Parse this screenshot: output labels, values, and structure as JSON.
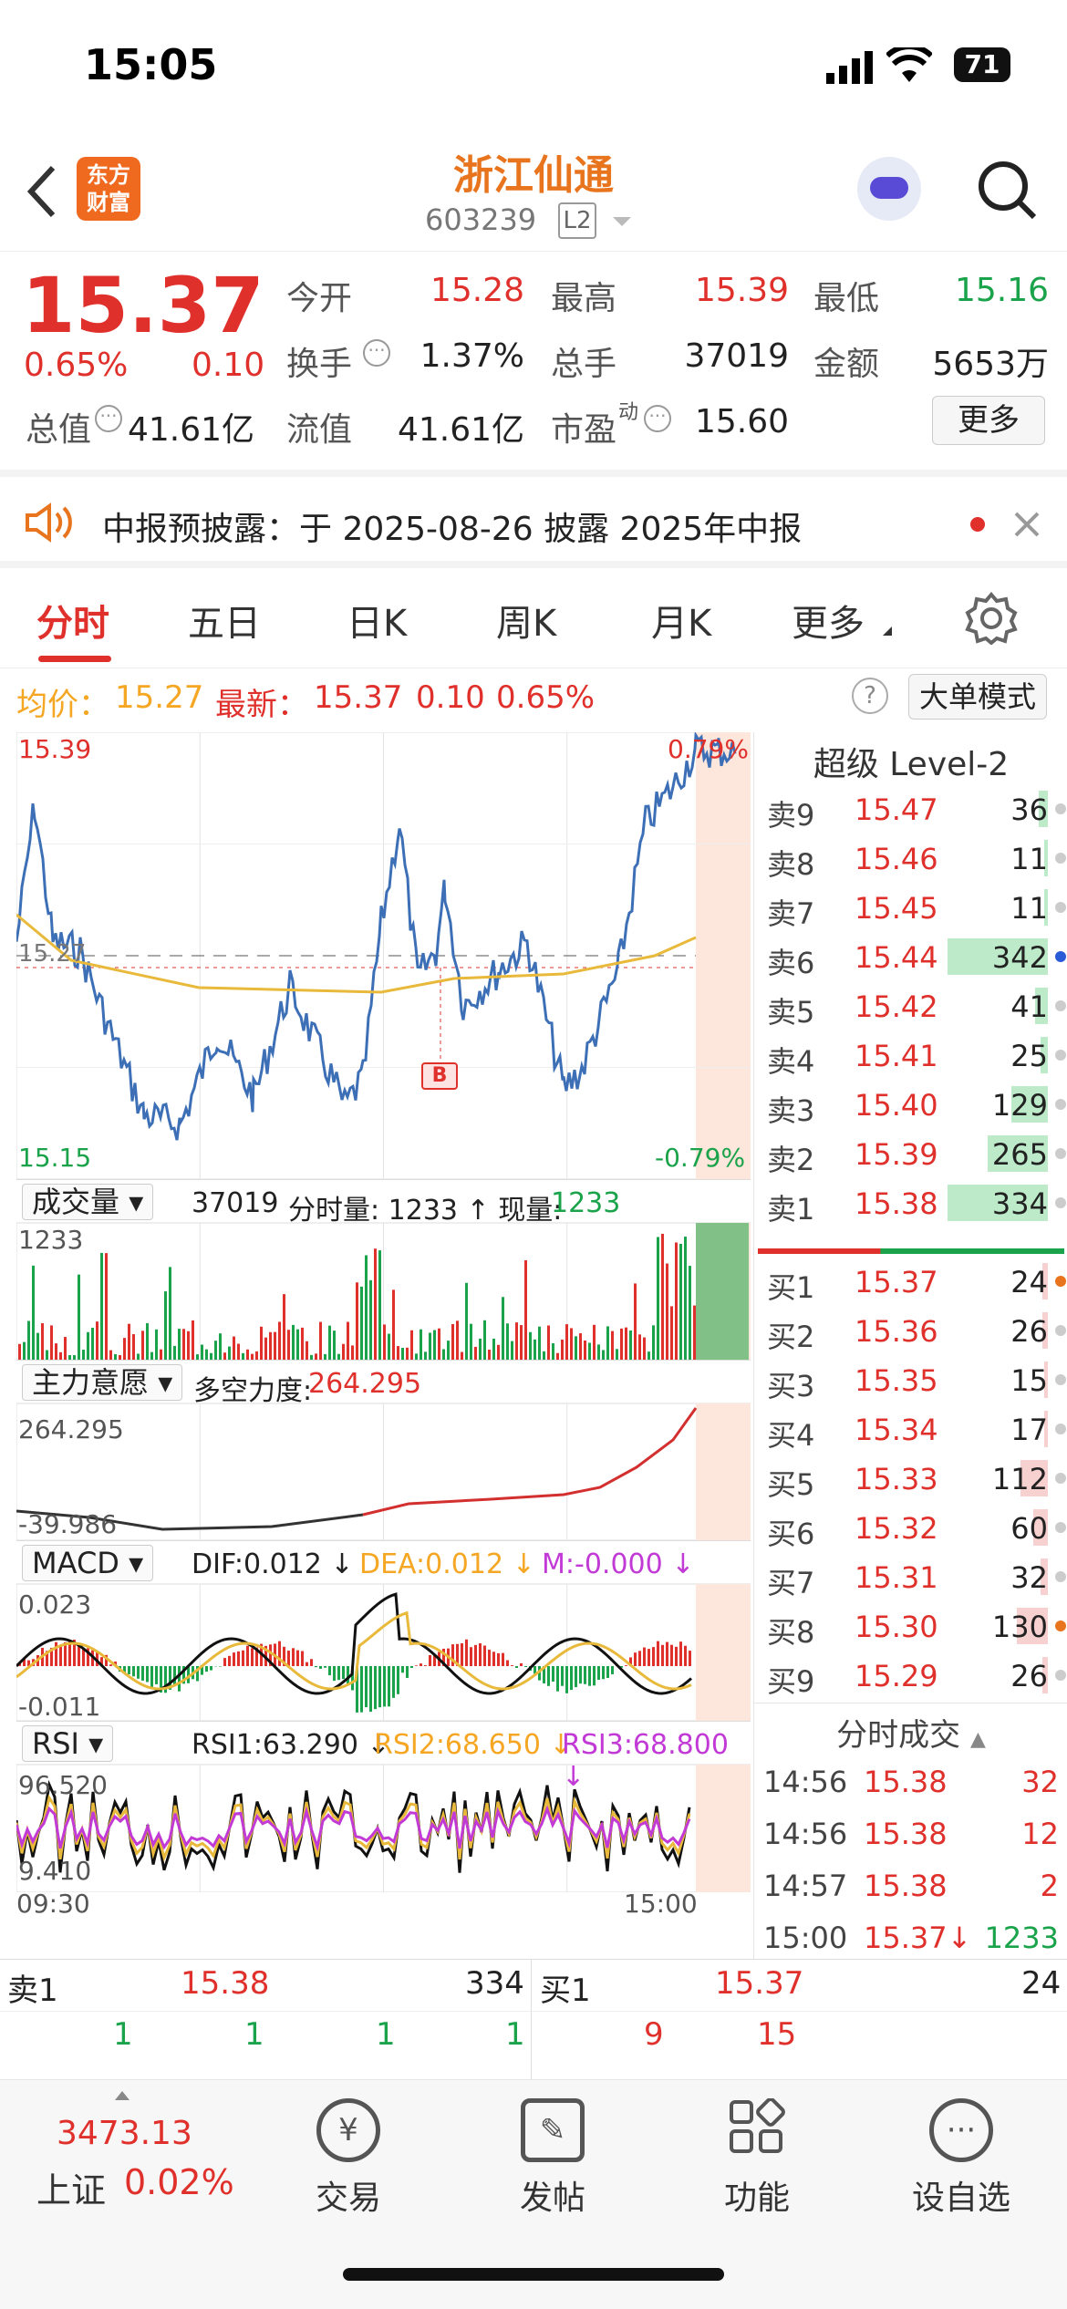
{
  "status": {
    "time": "15:05",
    "battery": "71"
  },
  "header": {
    "logo": "东方\n财富",
    "stock_name": "浙江仙通",
    "stock_code": "603239",
    "level_badge": "L2"
  },
  "quote": {
    "price": "15.37",
    "change_pct": "0.65%",
    "change": "0.10",
    "open_label": "今开",
    "open": "15.28",
    "high_label": "最高",
    "high": "15.39",
    "low_label": "最低",
    "low": "15.16",
    "turnover_label": "换手",
    "turnover": "1.37%",
    "volume_label": "总手",
    "volume": "37019",
    "amount_label": "金额",
    "amount": "5653万",
    "mcap_label": "总值",
    "mcap": "41.61亿",
    "float_label": "流值",
    "float": "41.61亿",
    "pe_label": "市盈",
    "pe_sup": "动",
    "pe": "15.60",
    "more": "更多"
  },
  "notice": {
    "text": "中报预披露：于 2025-08-26 披露 2025年中报"
  },
  "tabs": [
    "分时",
    "五日",
    "日K",
    "周K",
    "月K",
    "更多"
  ],
  "avg": {
    "avg_label": "均价：",
    "avg": "15.27",
    "latest_label": "最新：",
    "latest": "15.37",
    "chg": "0.10",
    "pct": "0.65%",
    "mode": "大单模式"
  },
  "chart": {
    "y_top": "15.39",
    "y_bottom": "15.15",
    "y_mid": "15.27",
    "pct_top": "0.79%",
    "pct_bottom": "-0.79%",
    "x_start": "09:30",
    "x_end": "15:00",
    "marker": "B"
  },
  "volume_panel": {
    "selector": "成交量",
    "total": "37019",
    "label": "分时量: 1233 ↑ 现量: ",
    "now": "1233",
    "y_top": "1233"
  },
  "force_panel": {
    "selector": "主力意愿",
    "label": "多空力度:",
    "value": "264.295",
    "y_top": "264.295",
    "y_bottom": "-39.986"
  },
  "macd_panel": {
    "selector": "MACD",
    "dif": "DIF:0.012 ↓",
    "dea": "DEA:0.012 ↓",
    "m": "M:-0.000 ↓",
    "y_top": "0.023",
    "y_bottom": "-0.011"
  },
  "rsi_panel": {
    "selector": "RSI",
    "rsi1": "RSI1:63.290 ↓",
    "rsi2": "RSI2:68.650 ↓",
    "rsi3": "RSI3:68.800 ↓",
    "y_top": "96.520",
    "y_bottom": "9.410"
  },
  "orderbook": {
    "title": "超级 Level-2",
    "asks": [
      {
        "l": "卖9",
        "p": "15.47",
        "v": "36"
      },
      {
        "l": "卖8",
        "p": "15.46",
        "v": "11"
      },
      {
        "l": "卖7",
        "p": "15.45",
        "v": "11"
      },
      {
        "l": "卖6",
        "p": "15.44",
        "v": "342"
      },
      {
        "l": "卖5",
        "p": "15.42",
        "v": "41"
      },
      {
        "l": "卖4",
        "p": "15.41",
        "v": "25"
      },
      {
        "l": "卖3",
        "p": "15.40",
        "v": "129"
      },
      {
        "l": "卖2",
        "p": "15.39",
        "v": "265"
      },
      {
        "l": "卖1",
        "p": "15.38",
        "v": "334"
      }
    ],
    "bids": [
      {
        "l": "买1",
        "p": "15.37",
        "v": "24"
      },
      {
        "l": "买2",
        "p": "15.36",
        "v": "26"
      },
      {
        "l": "买3",
        "p": "15.35",
        "v": "15"
      },
      {
        "l": "买4",
        "p": "15.34",
        "v": "17"
      },
      {
        "l": "买5",
        "p": "15.33",
        "v": "112"
      },
      {
        "l": "买6",
        "p": "15.32",
        "v": "60"
      },
      {
        "l": "买7",
        "p": "15.31",
        "v": "32"
      },
      {
        "l": "买8",
        "p": "15.30",
        "v": "130"
      },
      {
        "l": "买9",
        "p": "15.29",
        "v": "26"
      }
    ],
    "trades_title": "分时成交",
    "trades": [
      {
        "t": "14:56",
        "p": "15.38",
        "v": "32"
      },
      {
        "t": "14:56",
        "p": "15.38",
        "v": "12"
      },
      {
        "t": "14:57",
        "p": "15.38",
        "v": "2"
      },
      {
        "t": "15:00",
        "p": "15.37↓",
        "v": "1233"
      }
    ]
  },
  "depth": {
    "sell_label": "卖1",
    "sell_price": "15.38",
    "sell_vol": "334",
    "buy_label": "买1",
    "buy_price": "15.37",
    "buy_vol": "24",
    "sell_queue": [
      "1",
      "1",
      "1",
      "1"
    ],
    "buy_queue": [
      "9",
      "15"
    ]
  },
  "bottom": {
    "index_value": "3473.13",
    "index_name": "上证",
    "index_pct": "0.02%",
    "trade": "交易",
    "post": "发帖",
    "func": "功能",
    "watch": "设自选"
  }
}
